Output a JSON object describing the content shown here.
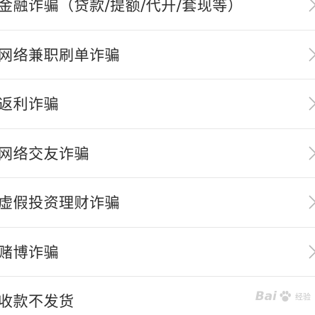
{
  "list": {
    "items": [
      {
        "label": "金融诈骗（贷款/提额/代开/套现等）"
      },
      {
        "label": "网络兼职刷单诈骗"
      },
      {
        "label": "返利诈骗"
      },
      {
        "label": "网络交友诈骗"
      },
      {
        "label": "虚假投资理财诈骗"
      },
      {
        "label": "赌博诈骗"
      },
      {
        "label": "收款不发货"
      }
    ],
    "chevron_icon": "chevron-right-icon"
  },
  "watermark": {
    "text_a": "Bai",
    "text_b": "经验",
    "icon": "paw-icon"
  },
  "colors": {
    "text": "#2e2e2e",
    "divider": "#e6e6e6",
    "chevron": "#b5b5b5",
    "background": "#ffffff"
  }
}
